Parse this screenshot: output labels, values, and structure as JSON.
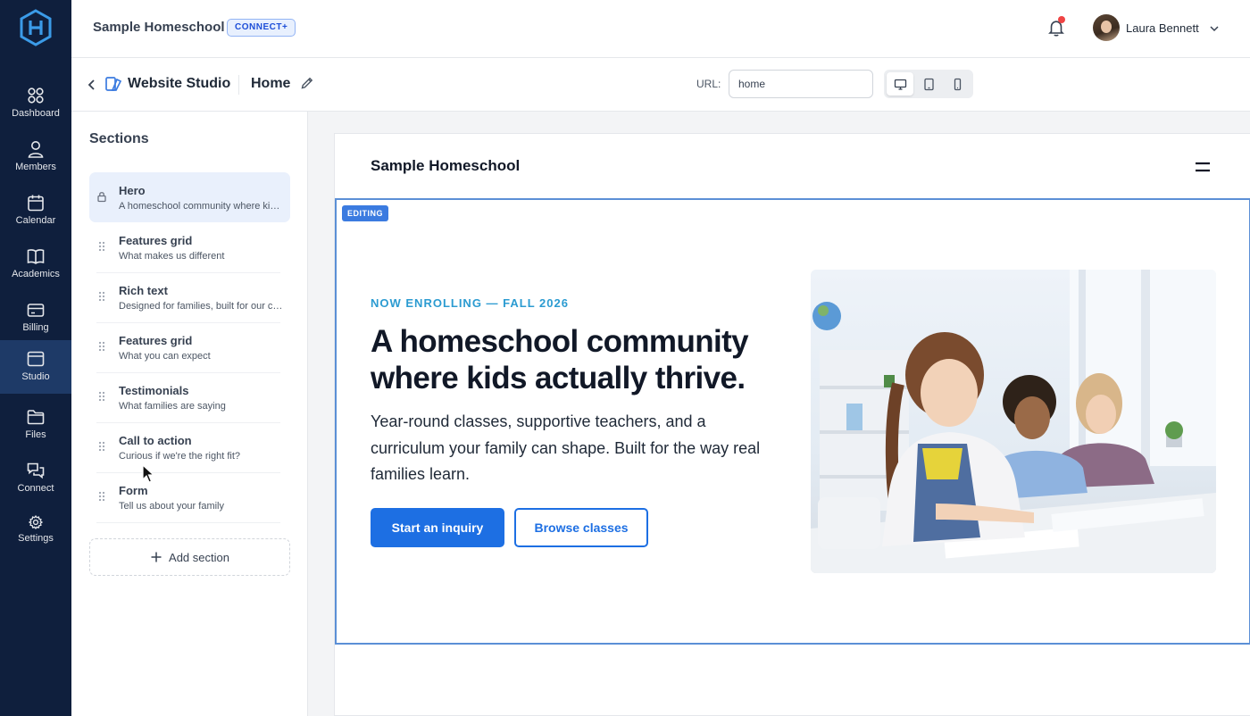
{
  "nav": {
    "items": [
      {
        "label": "Dashboard",
        "icon": "grid-icon"
      },
      {
        "label": "Members",
        "icon": "user-icon"
      },
      {
        "label": "Calendar",
        "icon": "calendar-icon"
      },
      {
        "label": "Academics",
        "icon": "book-icon"
      },
      {
        "label": "Billing",
        "icon": "credit-card-icon"
      },
      {
        "label": "Studio",
        "icon": "browser-icon",
        "active": true
      },
      {
        "label": "Files",
        "icon": "folder-icon"
      },
      {
        "label": "Connect",
        "icon": "chat-icon"
      },
      {
        "label": "Settings",
        "icon": "gear-icon"
      }
    ]
  },
  "header": {
    "org_name": "Sample Homeschool",
    "org_badge": "CONNECT+",
    "user_name": "Laura Bennett"
  },
  "studio": {
    "title": "Website Studio",
    "page_name": "Home",
    "url_label": "URL:",
    "url_value": "home"
  },
  "sections": {
    "title": "Sections",
    "items": [
      {
        "name": "Hero",
        "desc": "A homeschool community where kids actually thrive.",
        "locked": true,
        "active": true
      },
      {
        "name": "Features grid",
        "desc": "What makes us different"
      },
      {
        "name": "Rich text",
        "desc": "Designed for families, built for our community"
      },
      {
        "name": "Features grid",
        "desc": "What you can expect"
      },
      {
        "name": "Testimonials",
        "desc": "What families are saying"
      },
      {
        "name": "Call to action",
        "desc": "Curious if we're the right fit?"
      },
      {
        "name": "Form",
        "desc": "Tell us about your family"
      }
    ],
    "add_label": "Add section"
  },
  "preview": {
    "brand": "Sample Homeschool",
    "editing_badge": "EDITING",
    "eyebrow": "NOW ENROLLING — FALL 2026",
    "heading": "A homeschool community where kids actually thrive.",
    "body": "Year-round classes, supportive teachers, and a curriculum your family can shape. Built for the way real families learn.",
    "primary_cta": "Start an inquiry",
    "secondary_cta": "Browse classes"
  },
  "colors": {
    "nav_bg": "#0f1f3d",
    "accent": "#1d6fe3",
    "eyebrow": "#2b9bd1",
    "editing_frame": "#5b8fd6"
  }
}
